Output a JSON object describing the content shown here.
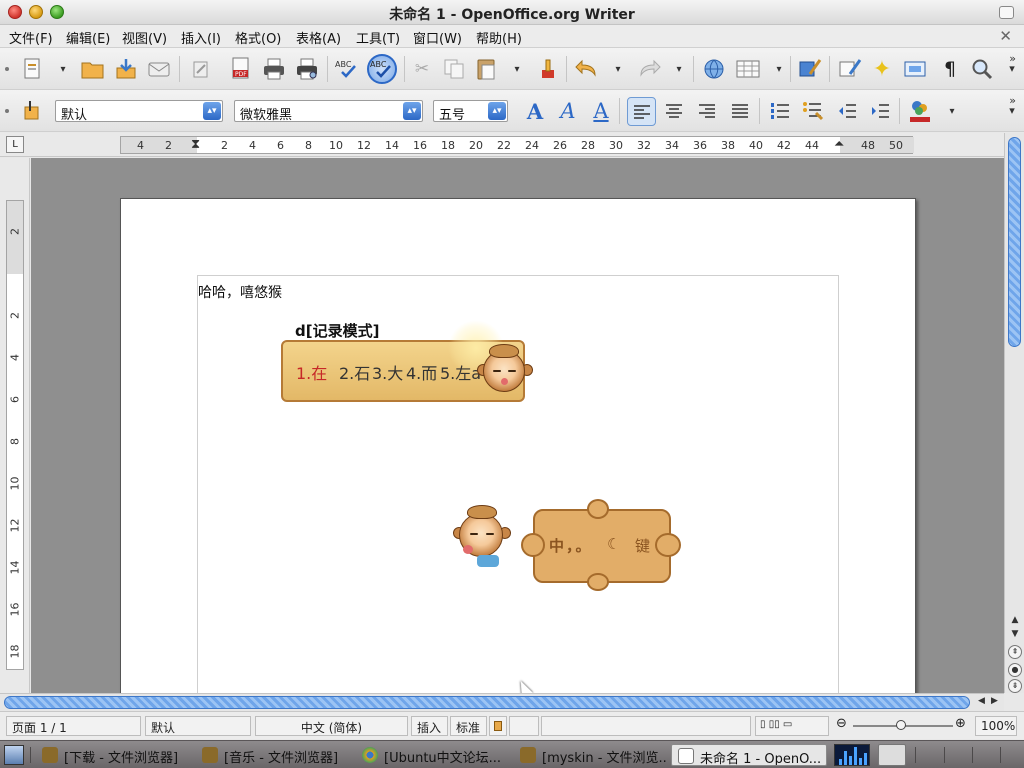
{
  "window": {
    "title": "未命名 1 - OpenOffice.org Writer"
  },
  "menu": {
    "items": [
      "文件(F)",
      "编辑(E)",
      "视图(V)",
      "插入(I)",
      "格式(O)",
      "表格(A)",
      "工具(T)",
      "窗口(W)",
      "帮助(H)"
    ]
  },
  "toolbar1": {
    "icons": [
      "new-document-icon",
      "open-folder-icon",
      "save-icon",
      "email-icon",
      "edit-file-icon",
      "export-pdf-icon",
      "print-icon",
      "print-preview-icon",
      "spellcheck-icon",
      "autospellcheck-icon",
      "cut-icon",
      "copy-icon",
      "paste-icon",
      "clone-formatting-icon",
      "undo-icon",
      "redo-icon",
      "hyperlink-icon",
      "table-icon",
      "draw-functions-icon",
      "navigator-icon",
      "gallery-icon",
      "datasources-icon",
      "formatting-marks-icon",
      "zoom-icon"
    ],
    "spell_labels": [
      "ABC",
      "ABC"
    ],
    "pdf_label": "PDF",
    "pilcrow": "¶"
  },
  "toolbar2": {
    "style": "默认",
    "font": "微软雅黑",
    "size": "五号",
    "font_effect_glyph": "A"
  },
  "ruler": {
    "tab_label": "L",
    "horizontal_labels": [
      "4",
      "2",
      "2",
      "4",
      "6",
      "8",
      "10",
      "12",
      "14",
      "16",
      "18",
      "20",
      "22",
      "24",
      "26",
      "28",
      "30",
      "32",
      "34",
      "36",
      "38",
      "40",
      "42",
      "44",
      "46",
      "48",
      "50"
    ],
    "vertical_labels": [
      "2",
      "2",
      "4",
      "6",
      "8",
      "10",
      "12",
      "14",
      "16",
      "18"
    ]
  },
  "document": {
    "body_text": "哈哈，嘻悠猴",
    "ime": {
      "input": "d[记录模式]",
      "candidates": [
        "1.在",
        "2.石",
        "3.大",
        "4.而",
        "5.左a"
      ]
    },
    "puzzle_label": "中，。",
    "puzzle_key": "键"
  },
  "statusbar": {
    "page": "页面 1 / 1",
    "style": "默认",
    "language": "中文 (简体)",
    "insert_mode": "插入",
    "selection_mode": "标准",
    "zoom": "100%"
  },
  "taskbar": {
    "tasks": [
      "[下载 - 文件浏览器]",
      "[音乐 - 文件浏览器]",
      "[Ubuntu中文论坛...",
      "[myskin - 文件浏览...",
      "未命名 1 - OpenO..."
    ]
  },
  "colors": {
    "accent": "#2c68c6",
    "ime_candidate_highlight": "#c62828",
    "ime_bg": "#e9c277"
  }
}
